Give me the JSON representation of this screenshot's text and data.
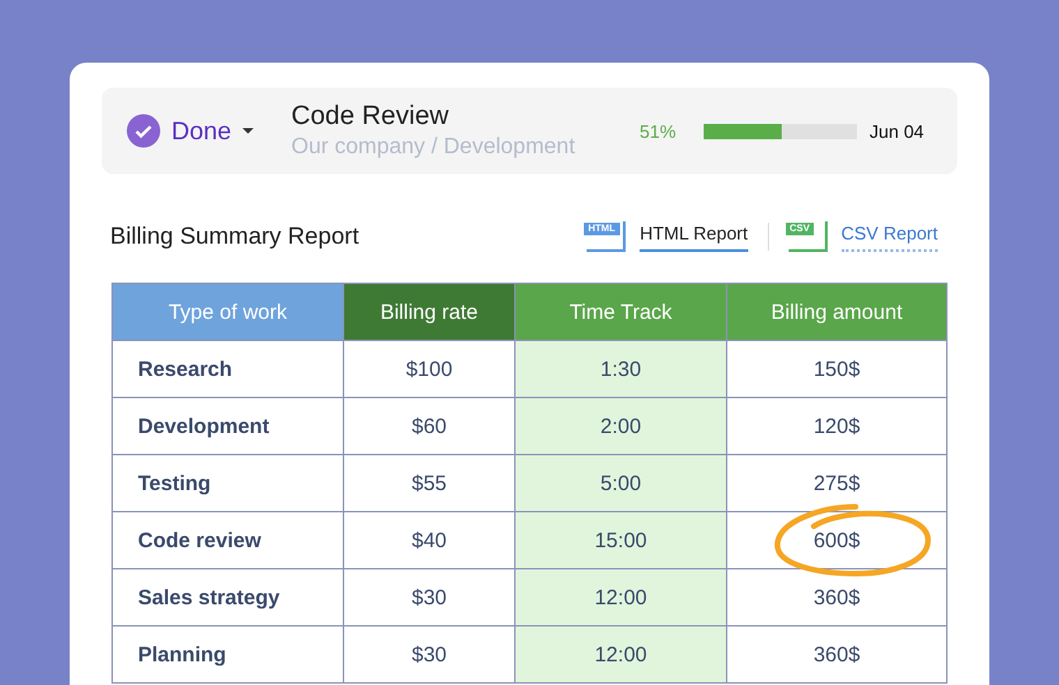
{
  "task": {
    "status": "Done",
    "title": "Code Review",
    "path": "Our company / Development",
    "progress": {
      "reading": "51%",
      "level": 0.51
    },
    "due": "Jun 04"
  },
  "report": {
    "title": "Billing Summary Report",
    "exports": [
      {
        "kind": "html",
        "badge": "HTML",
        "label": "HTML Report",
        "selected": true
      },
      {
        "kind": "csv",
        "badge": "CSV",
        "label": "CSV Report",
        "selected": false
      }
    ]
  },
  "table": {
    "columns": [
      "Type of work",
      "Billing rate",
      "Time Track",
      "Billing amount"
    ],
    "rows": [
      {
        "cells": [
          "Research",
          "$100",
          "1:30",
          "150$"
        ],
        "circled": false
      },
      {
        "cells": [
          "Development",
          "$60",
          "2:00",
          "120$"
        ],
        "circled": false
      },
      {
        "cells": [
          "Testing",
          "$55",
          "5:00",
          "275$"
        ],
        "circled": false
      },
      {
        "cells": [
          "Code review",
          "$40",
          "15:00",
          "600$"
        ],
        "circled": true
      },
      {
        "cells": [
          "Sales strategy",
          "$30",
          "12:00",
          "360$"
        ],
        "circled": false
      },
      {
        "cells": [
          "Planning",
          "$30",
          "12:00",
          "360$"
        ],
        "circled": false
      }
    ]
  }
}
